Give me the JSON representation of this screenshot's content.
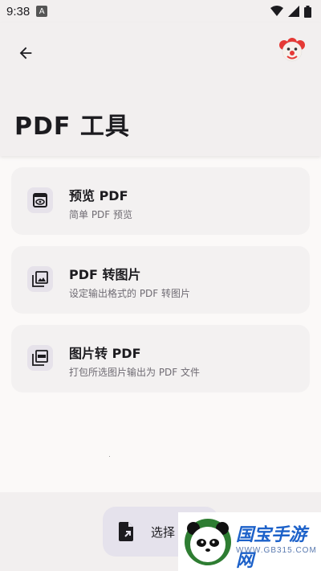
{
  "status_bar": {
    "time": "9:38",
    "notification_icon_label": "A",
    "icons": [
      "wifi-icon",
      "signal-icon",
      "battery-icon"
    ]
  },
  "header": {
    "title": "PDF 工具",
    "back_icon": "arrow-left-icon",
    "avatar_icon": "clown-face-icon"
  },
  "tools": [
    {
      "title": "预览 PDF",
      "subtitle": "简单 PDF 预览",
      "icon": "eye-document-icon"
    },
    {
      "title": "PDF 转图片",
      "subtitle": "设定输出格式的 PDF 转图片",
      "icon": "images-icon"
    },
    {
      "title": "图片转 PDF",
      "subtitle": "打包所选图片输出为 PDF 文件",
      "icon": "pdf-stack-icon"
    }
  ],
  "bottom": {
    "select_label": "选择",
    "select_icon": "file-open-icon"
  },
  "watermark": {
    "text": "国宝手游网",
    "url": "WWW.GB315.COM"
  },
  "colors": {
    "accent": "#e5e2ec",
    "surface": "#f2efef",
    "background": "#fbf9f8",
    "watermark_blue": "#1c61c9"
  }
}
